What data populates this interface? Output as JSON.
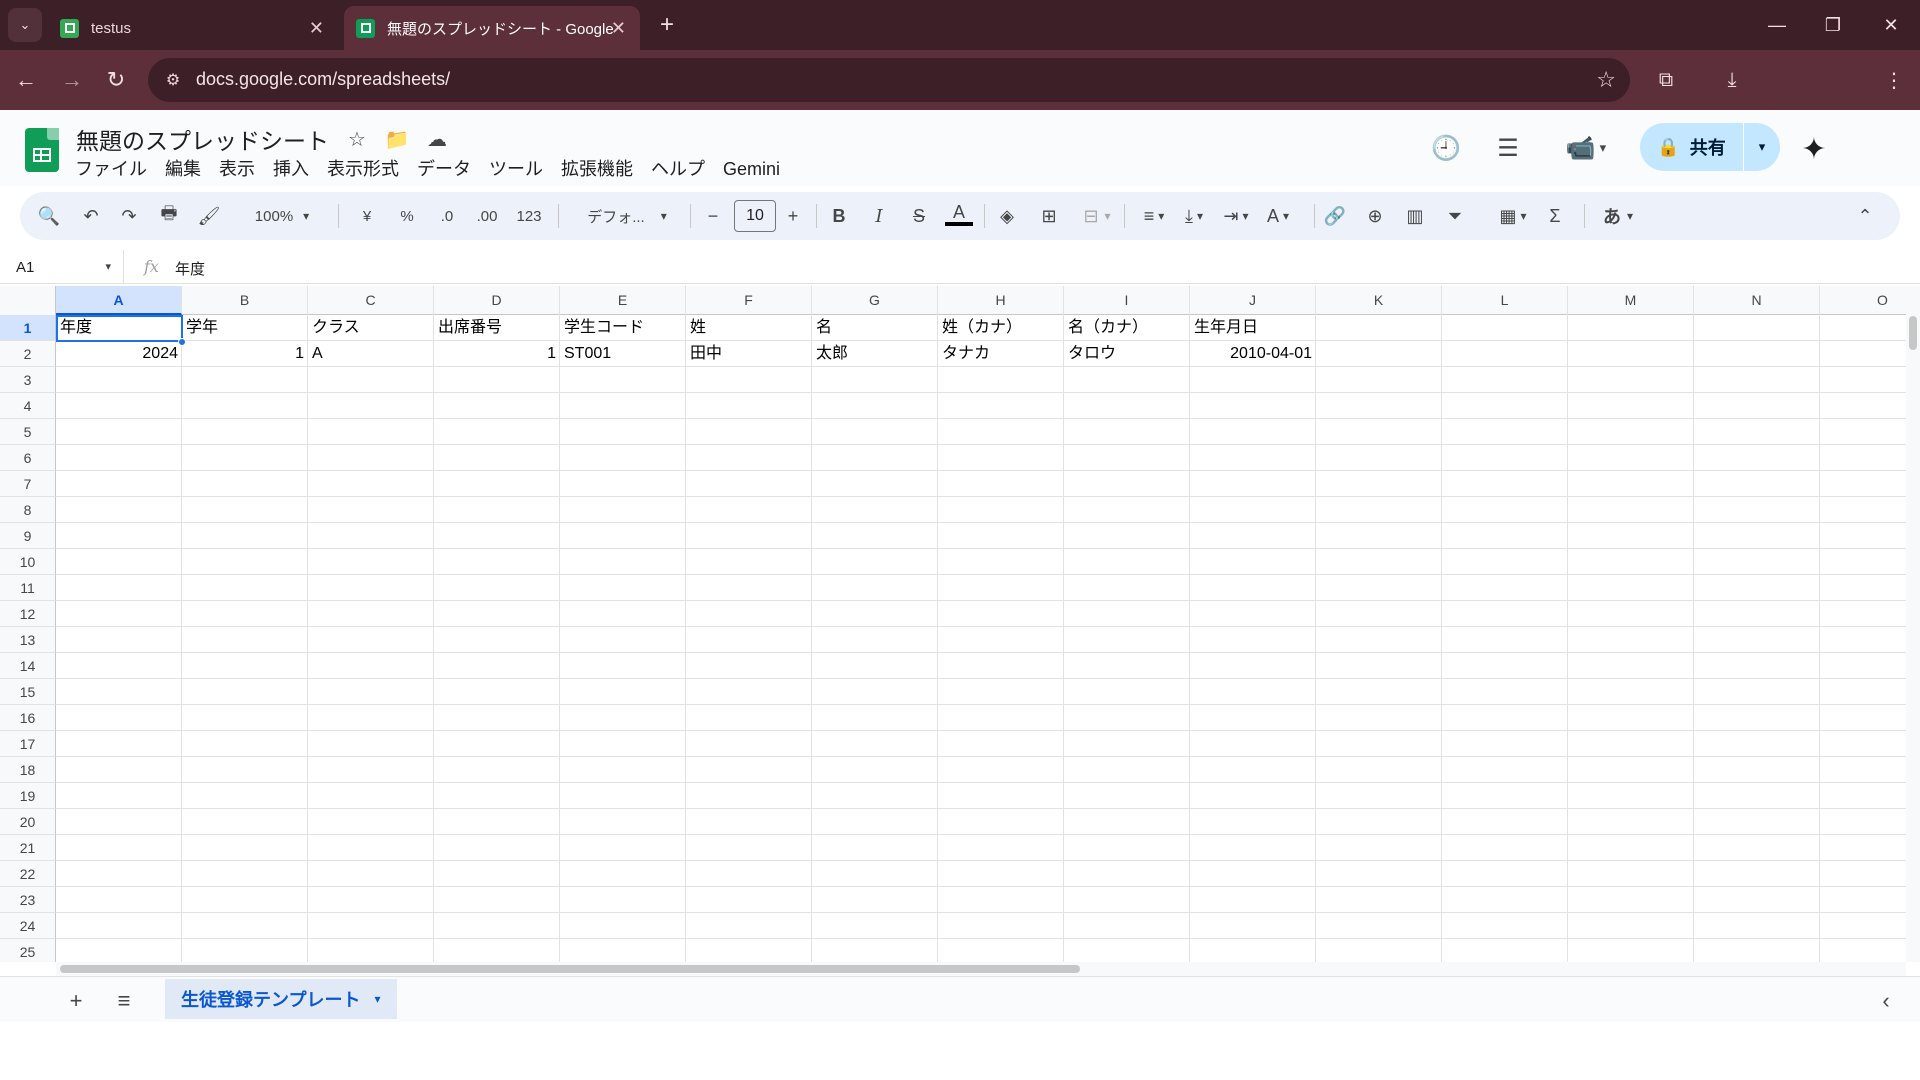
{
  "browser": {
    "tabs": [
      {
        "title": "testus",
        "favicon_color": "#34a853"
      },
      {
        "title": "無題のスプレッドシート - Google ス",
        "favicon_color": "#0f9d58"
      }
    ],
    "url": "docs.google.com/spreadsheets/"
  },
  "icons": {
    "tab_dropdown": "⌄",
    "close": "✕",
    "new_tab": "+",
    "minimize": "—",
    "restore": "❐",
    "win_close": "✕",
    "back": "←",
    "forward": "→",
    "reload": "↻",
    "site_info": "⚙",
    "bookmark": "☆",
    "extensions": "⧉",
    "download": "⤓",
    "menu": "⋮",
    "star": "☆",
    "move": "📁",
    "cloud": "☁",
    "history": "🕘",
    "comment": "☰",
    "meet": "📹",
    "lock": "🔒",
    "caret": "▾",
    "spark": "✦",
    "search": "🔍",
    "undo": "↶",
    "redo": "↷",
    "print": "🖶",
    "paint": "🖌",
    "bold": "B",
    "italic": "I",
    "strike": "S",
    "textcolor": "A",
    "fill": "◈",
    "borders": "⊞",
    "merge": "⊟",
    "halign": "≡",
    "valign": "⤓",
    "wrap": "⇥",
    "rotate": "A",
    "link": "🔗",
    "comment_add": "⊕",
    "chart": "▥",
    "filter": "⏷",
    "table": "▦",
    "sigma": "Σ",
    "ime": "あ",
    "collapse": "⌃",
    "add_sheet": "+",
    "all_sheets": "≡",
    "side_collapse": "‹"
  },
  "app": {
    "title": "無題のスプレッドシート",
    "menu": [
      "ファイル",
      "編集",
      "表示",
      "挿入",
      "表示形式",
      "データ",
      "ツール",
      "拡張機能",
      "ヘルプ",
      "Gemini"
    ],
    "share_label": "共有"
  },
  "toolbar": {
    "zoom": "100%",
    "currency": "¥",
    "percent": "%",
    "dec_decrease": ".0",
    "dec_increase": ".00",
    "number_format": "123",
    "font": "デフォ...",
    "minus": "−",
    "font_size": "10",
    "plus": "+"
  },
  "formula": {
    "cell_ref": "A1",
    "fx": "fx",
    "content": "年度"
  },
  "sheet": {
    "columns": [
      "A",
      "B",
      "C",
      "D",
      "E",
      "F",
      "G",
      "H",
      "I",
      "J",
      "K",
      "L",
      "M",
      "N",
      "O"
    ],
    "rows": [
      "1",
      "2",
      "3",
      "4",
      "5",
      "6",
      "7",
      "8",
      "9",
      "10",
      "11",
      "12",
      "13",
      "14",
      "15",
      "16",
      "17",
      "18",
      "19",
      "20",
      "21",
      "22",
      "23",
      "24",
      "25"
    ],
    "header_row": [
      "年度",
      "学年",
      "クラス",
      "出席番号",
      "学生コード",
      "姓",
      "名",
      "姓（カナ）",
      "名（カナ）",
      "生年月日"
    ],
    "data_row": [
      "2024",
      "1",
      "A",
      "1",
      "ST001",
      "田中",
      "太郎",
      "タナカ",
      "タロウ",
      "2010-04-01"
    ],
    "numeric_columns": [
      0,
      1,
      3,
      9
    ],
    "active_sheet": "生徒登録テンプレート"
  }
}
